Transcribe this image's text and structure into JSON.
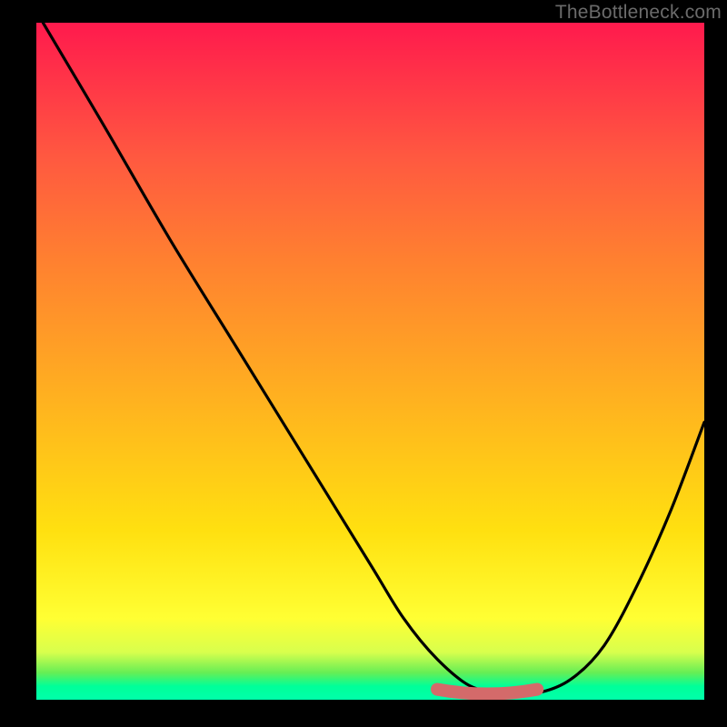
{
  "watermark": "TheBottleneck.com",
  "chart_data": {
    "type": "line",
    "title": "",
    "xlabel": "",
    "ylabel": "",
    "xlim": [
      0,
      100
    ],
    "ylim": [
      0,
      100
    ],
    "grid": false,
    "legend": false,
    "series": [
      {
        "name": "bottleneck-curve",
        "color": "#000000",
        "x": [
          1,
          10,
          20,
          30,
          40,
          50,
          55,
          60,
          65,
          70,
          75,
          80,
          85,
          90,
          95,
          100
        ],
        "y": [
          100,
          85,
          68,
          52,
          36,
          20,
          12,
          6,
          2,
          1,
          1,
          3,
          8,
          17,
          28,
          41
        ]
      },
      {
        "name": "optimal-band",
        "color": "#d46a6a",
        "type": "area",
        "x": [
          60,
          75
        ],
        "y": [
          1,
          1
        ]
      }
    ],
    "annotations": []
  },
  "colors": {
    "frame": "#000000",
    "gradient_top": "#ff1a4d",
    "gradient_bottom": "#00ff99",
    "curve": "#000000",
    "band": "#d46a6a",
    "watermark": "#6b6b6b"
  }
}
